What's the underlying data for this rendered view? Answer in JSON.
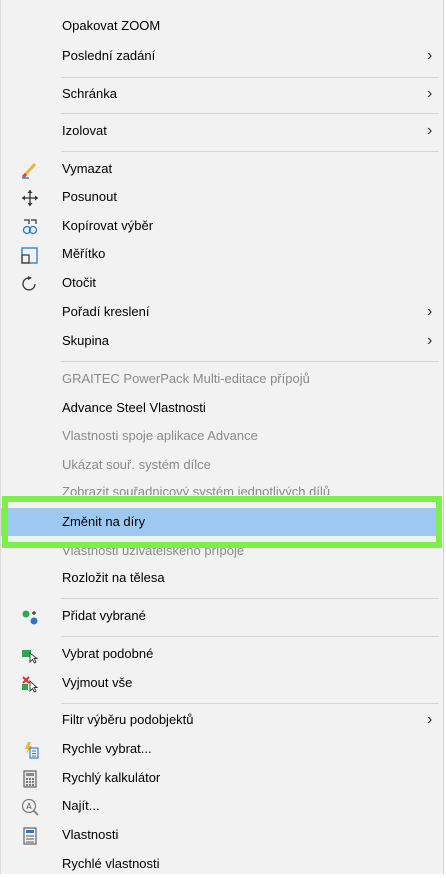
{
  "menu": {
    "items": [
      {
        "label": "Opakovat ZOOM"
      },
      {
        "label": "Poslední zadání",
        "arrow": "›"
      },
      {
        "label": "Schránka",
        "arrow": "›"
      },
      {
        "label": "Izolovat",
        "arrow": "›"
      },
      {
        "label": "Vymazat",
        "icon": "eraser-icon"
      },
      {
        "label": "Posunout",
        "icon": "move-icon"
      },
      {
        "label": "Kopírovat výběr",
        "icon": "copy-icon"
      },
      {
        "label": "Měřítko",
        "icon": "scale-icon"
      },
      {
        "label": "Otočit",
        "icon": "rotate-icon"
      },
      {
        "label": "Pořadí kreslení",
        "arrow": "›"
      },
      {
        "label": "Skupina",
        "arrow": "›"
      },
      {
        "label": "GRAITEC PowerPack Multi-editace přípojů"
      },
      {
        "label": "Advance Steel Vlastnosti"
      },
      {
        "label": "Vlastnosti spoje aplikace Advance"
      },
      {
        "label": "Ukázat souř. systém dílce"
      },
      {
        "label": "Zobrazit souřadnicový systém jednotlivých dílů"
      },
      {
        "label": "Změnit na díry"
      },
      {
        "label": "Vlastnosti uživatelského přípoje"
      },
      {
        "label": "Rozložit na tělesa"
      },
      {
        "label": "Přidat vybrané",
        "icon": "add-selected-icon"
      },
      {
        "label": "Vybrat podobné",
        "icon": "select-similar-icon"
      },
      {
        "label": "Vyjmout vše",
        "icon": "deselect-all-icon"
      },
      {
        "label": "Filtr výběru podobjektů",
        "arrow": "›"
      },
      {
        "label": "Rychle vybrat...",
        "icon": "quick-select-icon"
      },
      {
        "label": "Rychlý kalkulátor",
        "icon": "calculator-icon"
      },
      {
        "label": "Najít...",
        "icon": "find-icon"
      },
      {
        "label": "Vlastnosti",
        "icon": "properties-icon"
      },
      {
        "label": "Rychlé vlastnosti"
      }
    ]
  },
  "colors": {
    "selected": "#9cc8f2",
    "highlight": "#7cf04a",
    "disabled": "#8a8a8a"
  }
}
